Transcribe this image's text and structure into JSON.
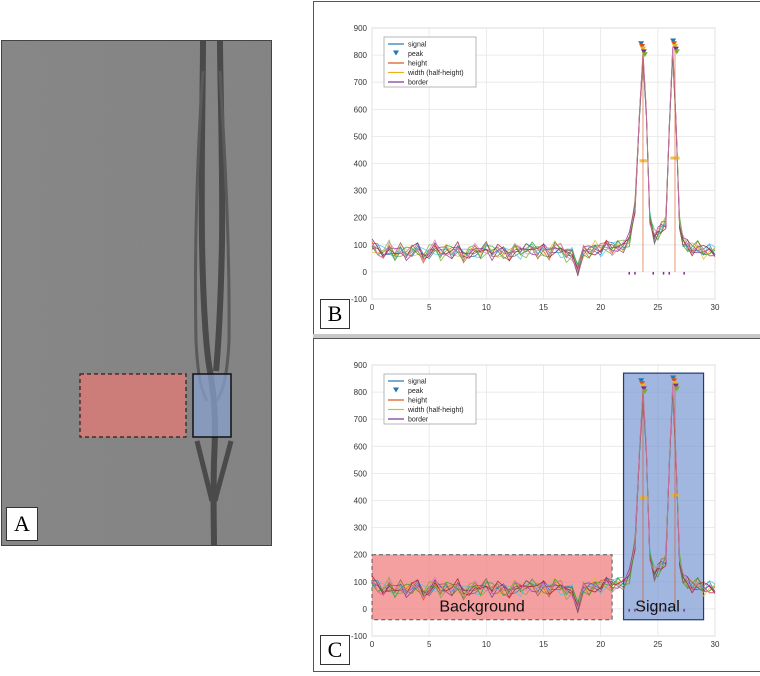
{
  "panels": {
    "a": {
      "label": "A"
    },
    "b": {
      "label": "B"
    },
    "c": {
      "label": "C",
      "regions": {
        "background": "Background",
        "signal": "Signal"
      }
    }
  },
  "colors": {
    "background_region": "#f08080",
    "signal_region": "#7090d0",
    "signal_line": "#1f77b4",
    "peak_marker": "#1f77b4",
    "height": "#d95319",
    "width": "#edb120",
    "border": "#7e2f8e"
  },
  "chart_data": [
    {
      "panel": "B",
      "type": "line",
      "xlim": [
        0,
        30
      ],
      "ylim": [
        -100,
        900
      ],
      "xticks": [
        0,
        5,
        10,
        15,
        20,
        25,
        30
      ],
      "yticks": [
        -100,
        0,
        100,
        200,
        300,
        400,
        500,
        600,
        700,
        800,
        900
      ],
      "grid": true,
      "legend": [
        "signal",
        "peak",
        "height",
        "width (half-height)",
        "border"
      ],
      "legend_position": "top-left",
      "x": [
        0,
        0.5,
        1,
        1.5,
        2,
        2.5,
        3,
        3.5,
        4,
        4.5,
        5,
        5.5,
        6,
        6.5,
        7,
        7.5,
        8,
        8.5,
        9,
        9.5,
        10,
        10.5,
        11,
        11.5,
        12,
        12.5,
        13,
        13.5,
        14,
        14.5,
        15,
        15.5,
        16,
        16.5,
        17,
        17.5,
        18,
        18.5,
        19,
        19.5,
        20,
        20.5,
        21,
        21.5,
        22,
        22.5,
        23,
        23.4,
        23.7,
        24,
        24.3,
        24.7,
        25,
        25.3,
        25.7,
        26,
        26.3,
        26.6,
        26.9,
        27.2,
        27.6,
        28,
        28.5,
        29,
        29.5,
        30
      ],
      "series_mean": [
        95,
        80,
        70,
        90,
        60,
        80,
        65,
        75,
        85,
        60,
        75,
        90,
        65,
        80,
        70,
        85,
        60,
        75,
        80,
        65,
        90,
        70,
        80,
        75,
        65,
        85,
        70,
        80,
        90,
        75,
        85,
        70,
        95,
        80,
        60,
        70,
        10,
        80,
        75,
        90,
        80,
        95,
        85,
        100,
        95,
        120,
        240,
        600,
        820,
        600,
        200,
        130,
        140,
        160,
        180,
        550,
        840,
        560,
        180,
        110,
        95,
        80,
        90,
        70,
        80,
        75
      ],
      "peaks": [
        {
          "x": 23.7,
          "y": 840
        },
        {
          "x": 26.5,
          "y": 850
        }
      ],
      "half_height": [
        {
          "x_from": 23.4,
          "x_to": 24.1,
          "y": 410
        },
        {
          "x_from": 26.1,
          "x_to": 26.9,
          "y": 420
        }
      ],
      "borders": [
        22.5,
        23.0,
        24.6,
        25.5,
        26.0,
        27.3
      ]
    },
    {
      "panel": "C",
      "type": "line",
      "xlim": [
        0,
        30
      ],
      "ylim": [
        -100,
        900
      ],
      "xticks": [
        0,
        5,
        10,
        15,
        20,
        25,
        30
      ],
      "yticks": [
        -100,
        0,
        100,
        200,
        300,
        400,
        500,
        600,
        700,
        800,
        900
      ],
      "grid": true,
      "legend": [
        "signal",
        "peak",
        "height",
        "width (half-height)",
        "border"
      ],
      "legend_position": "top-left",
      "regions": [
        {
          "name": "Background",
          "x_from": 0,
          "x_to": 21,
          "y_from": -40,
          "y_to": 200
        },
        {
          "name": "Signal",
          "x_from": 22,
          "x_to": 29,
          "y_from": -40,
          "y_to": 870
        }
      ]
    }
  ]
}
